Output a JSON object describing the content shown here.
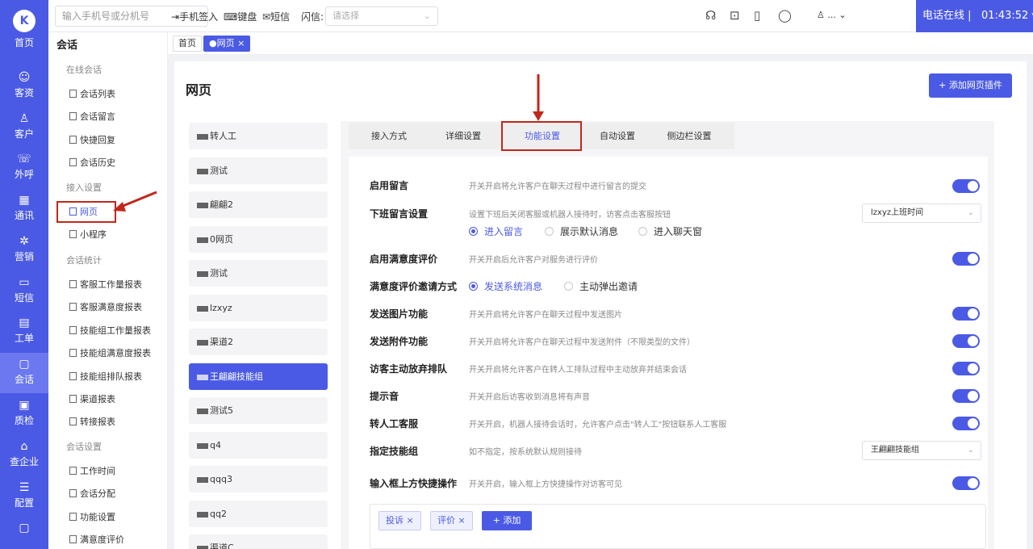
{
  "rail": {
    "logo_label": "首页",
    "items": [
      {
        "label": "客资",
        "icon": "people-icon"
      },
      {
        "label": "客户",
        "icon": "user-icon"
      },
      {
        "label": "外呼",
        "icon": "phone-out-icon"
      },
      {
        "label": "通讯",
        "icon": "contacts-icon"
      },
      {
        "label": "营销",
        "icon": "marketing-icon"
      },
      {
        "label": "短信",
        "icon": "sms-icon"
      },
      {
        "label": "工单",
        "icon": "ticket-icon"
      },
      {
        "label": "会话",
        "icon": "chat-icon"
      },
      {
        "label": "质检",
        "icon": "qc-icon"
      },
      {
        "label": "查企业",
        "icon": "enterprise-icon"
      },
      {
        "label": "配置",
        "icon": "config-icon"
      }
    ]
  },
  "topbar": {
    "search_placeholder": "输入手机号或分机号",
    "phone_checkin": "手机签入",
    "keyboard": "键盘",
    "sms": "短信",
    "flash_label": "闪信:",
    "flash_select_placeholder": "请选择",
    "user_name": "...",
    "phone_status": "电话在线",
    "timer": "01:43:52"
  },
  "submenu": {
    "title": "会话",
    "groups": [
      {
        "label": "在线会话",
        "items": [
          "会话列表",
          "会话留言",
          "快捷回复",
          "会话历史"
        ]
      },
      {
        "label": "接入设置",
        "items": [
          "网页",
          "小程序"
        ]
      },
      {
        "label": "会话统计",
        "items": [
          "客服工作量报表",
          "客服满意度报表",
          "技能组工作量报表",
          "技能组满意度报表",
          "技能组排队报表",
          "渠道报表",
          "转接报表"
        ]
      },
      {
        "label": "会话设置",
        "items": [
          "工作时间",
          "会话分配",
          "功能设置",
          "满意度评价"
        ]
      }
    ]
  },
  "page_tabs": [
    "首页",
    "●网页 ×"
  ],
  "main": {
    "title": "网页",
    "add_plugin": "+ 添加网页插件"
  },
  "channels": [
    "转人工",
    "测试",
    "翩翩2",
    "0网页",
    "测试",
    "lzxyz",
    "渠道2",
    "王翩翩技能组",
    "测试5",
    "q4",
    "qqq3",
    "qq2",
    "渠道C"
  ],
  "settings": {
    "tabs": [
      "接入方式",
      "详细设置",
      "功能设置",
      "自动设置",
      "侧边栏设置"
    ],
    "rows": {
      "leave_msg": {
        "label": "启用留言",
        "desc": "开关开启将允许客户在聊天过程中进行留言的提交"
      },
      "offduty": {
        "label": "下班留言设置",
        "desc": "设置下班后关闭客服或机器人接待时，访客点击客服按钮",
        "select": "lzxyz上班时间",
        "options": [
          "进入留言",
          "展示默认消息",
          "进入聊天窗"
        ]
      },
      "satisfaction": {
        "label": "启用满意度评价",
        "desc": "开关开启后允许客户对服务进行评价"
      },
      "invite": {
        "label": "满意度评价邀请方式",
        "options": [
          "发送系统消息",
          "主动弹出邀请"
        ]
      },
      "image": {
        "label": "发送图片功能",
        "desc": "开关开启将允许客户在聊天过程中发送图片"
      },
      "attach": {
        "label": "发送附件功能",
        "desc": "开关开启将允许客户在聊天过程中发送附件（不限类型的文件）"
      },
      "abandon": {
        "label": "访客主动放弃排队",
        "desc": "开关开启将允许客户在转人工排队过程中主动放弃并结束会话"
      },
      "sound": {
        "label": "提示音",
        "desc": "开关开启后访客收到消息将有声音"
      },
      "transfer": {
        "label": "转人工客服",
        "desc": "开关开启，机器人接待会话时，允许客户点击\"转人工\"按钮联系人工客服"
      },
      "skill": {
        "label": "指定技能组",
        "desc": "如不指定，按系统默认规则接待",
        "select": "王翩翩技能组"
      },
      "quick": {
        "label": "输入框上方快捷操作",
        "desc": "开关开启，输入框上方快捷操作对访客可见"
      }
    },
    "tags": [
      "投诉 ×",
      "评价 ×"
    ],
    "tag_add": "+ 添加"
  },
  "colors": {
    "accent": "#4b5ae4",
    "highlight": "#c0281b"
  }
}
